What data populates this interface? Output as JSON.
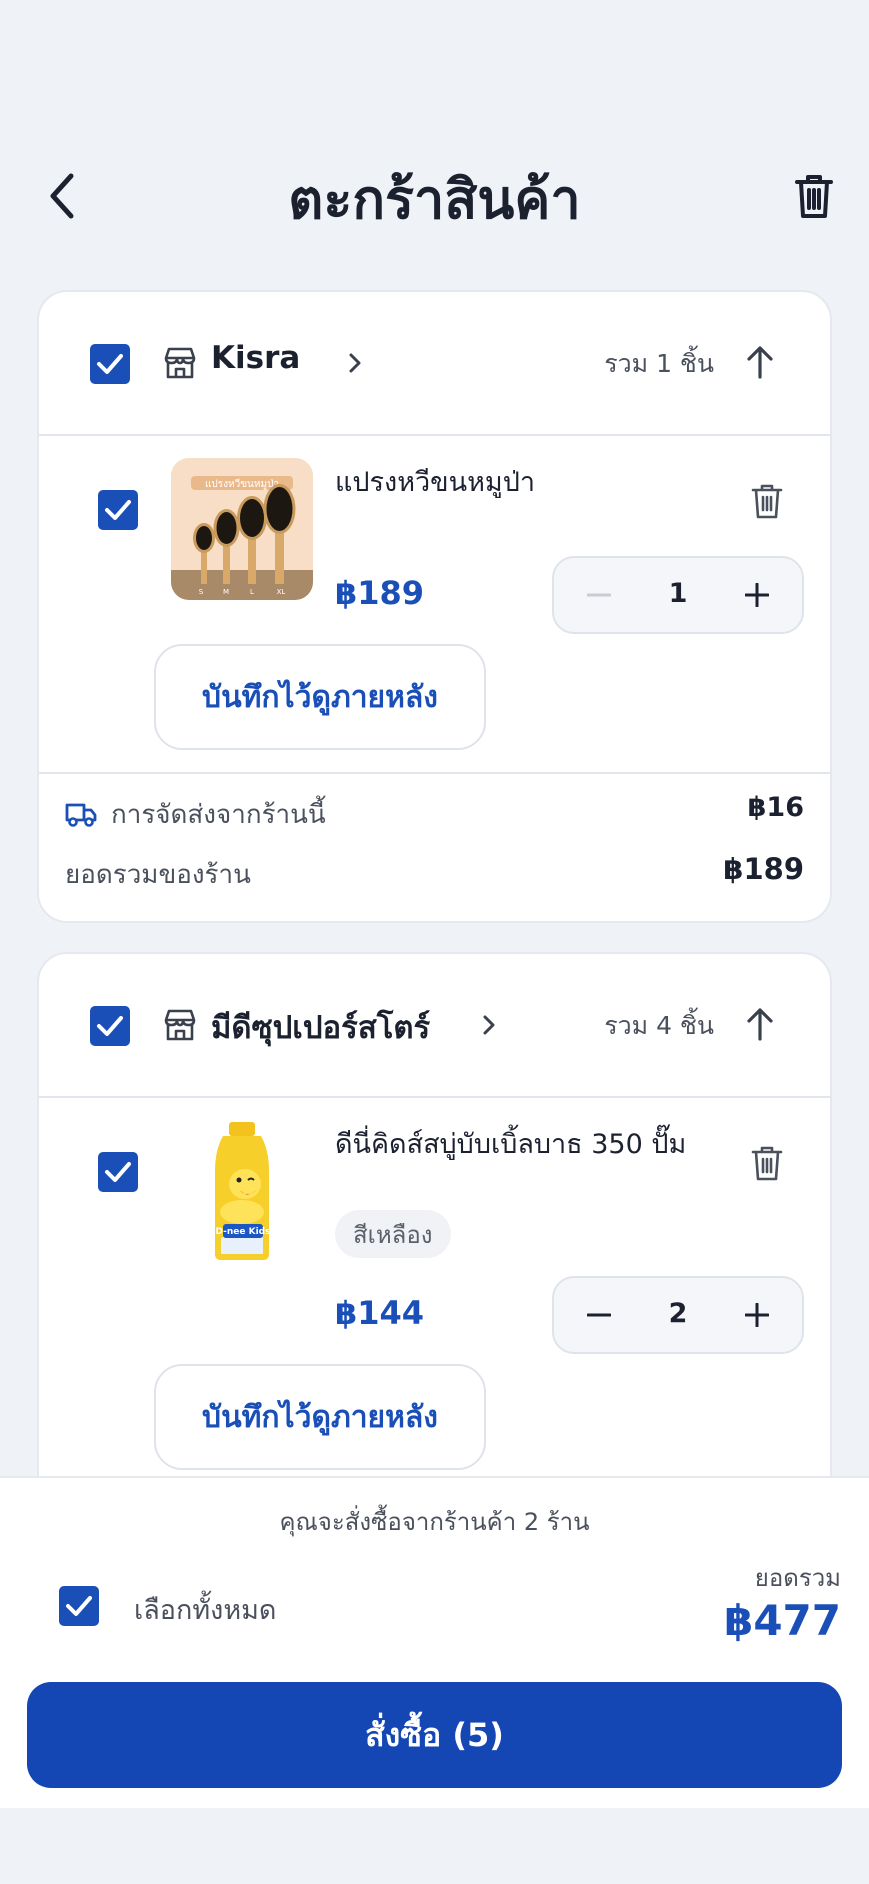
{
  "header": {
    "title": "ตะกร้าสินค้า"
  },
  "shops": [
    {
      "name": "Kisra",
      "count_label": "รวม 1 ชิ้น",
      "items": [
        {
          "title": "แปรงหวีขนหมูป่า",
          "price": "฿189",
          "quantity": "1",
          "save_label": "บันทึกไว้ดูภายหลัง",
          "thumb_text": "แปรงหวีขนหมูป่า",
          "sizes": [
            "S",
            "M",
            "L",
            "XL"
          ]
        }
      ],
      "shipping_label": "การจัดส่งจากร้านนี้",
      "shipping_value": "฿16",
      "subtotal_label": "ยอดรวมของร้าน",
      "subtotal_value": "฿189"
    },
    {
      "name": "มีดีซุปเปอร์สโตร์",
      "count_label": "รวม 4 ชิ้น",
      "items": [
        {
          "title": "ดีนี่คิดส์สบู่บับเบิ้ลบาธ 350 ปั๊ม",
          "variant": "สีเหลือง",
          "price": "฿144",
          "quantity": "2",
          "save_label": "บันทึกไว้ดูภายหลัง",
          "thumb_text": "D-nee Kids"
        }
      ]
    }
  ],
  "footer": {
    "note": "คุณจะสั่งซื้อจากร้านค้า 2 ร้าน",
    "select_all_label": "เลือกทั้งหมด",
    "total_label": "ยอดรวม",
    "total_value": "฿477",
    "order_label": "สั่งซื้อ (5)"
  },
  "colors": {
    "accent": "#1a4fb8",
    "button": "#1447b4",
    "background": "#eff2f7"
  }
}
